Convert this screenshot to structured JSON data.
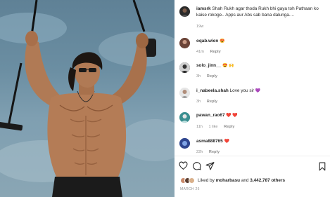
{
  "post": {
    "username": "iamsrk",
    "caption": "Shah Rukh agar thoda Rukh bhi gaya toh Pathaan ko kaise rokoge.. Apps aur Abs sab bana dalunga....",
    "age": "19w"
  },
  "comments": [
    {
      "user": "oqab.wien",
      "text": "",
      "emoji": "😍",
      "age": "41m",
      "reply": "Reply"
    },
    {
      "user": "solo_jinn__",
      "text": "",
      "emoji": "😍 🙌",
      "age": "3h",
      "reply": "Reply"
    },
    {
      "user": "i_nabeela.shah",
      "text": "Love you sir",
      "emoji": "💜",
      "age": "3h",
      "reply": "Reply"
    },
    {
      "user": "pawan_rao67",
      "text": "",
      "emoji": "❤️ ❤️",
      "age": "11h",
      "likes": "1 like",
      "reply": "Reply"
    },
    {
      "user": "asma888765",
      "text": "",
      "emoji": "❤️",
      "age": "22h",
      "reply": "Reply"
    }
  ],
  "likes": {
    "prefix": "Liked by",
    "by": "moharbasu",
    "and": "and",
    "others": "3,442,787 others"
  },
  "date": "MARCH 26",
  "icons": [
    "heart-icon",
    "comment-icon",
    "share-icon",
    "bookmark-icon"
  ],
  "colors": {
    "text": "#262626",
    "muted": "#8e8e8e",
    "heart": "#ed4956",
    "purple_heart": "#8a4bd8"
  }
}
